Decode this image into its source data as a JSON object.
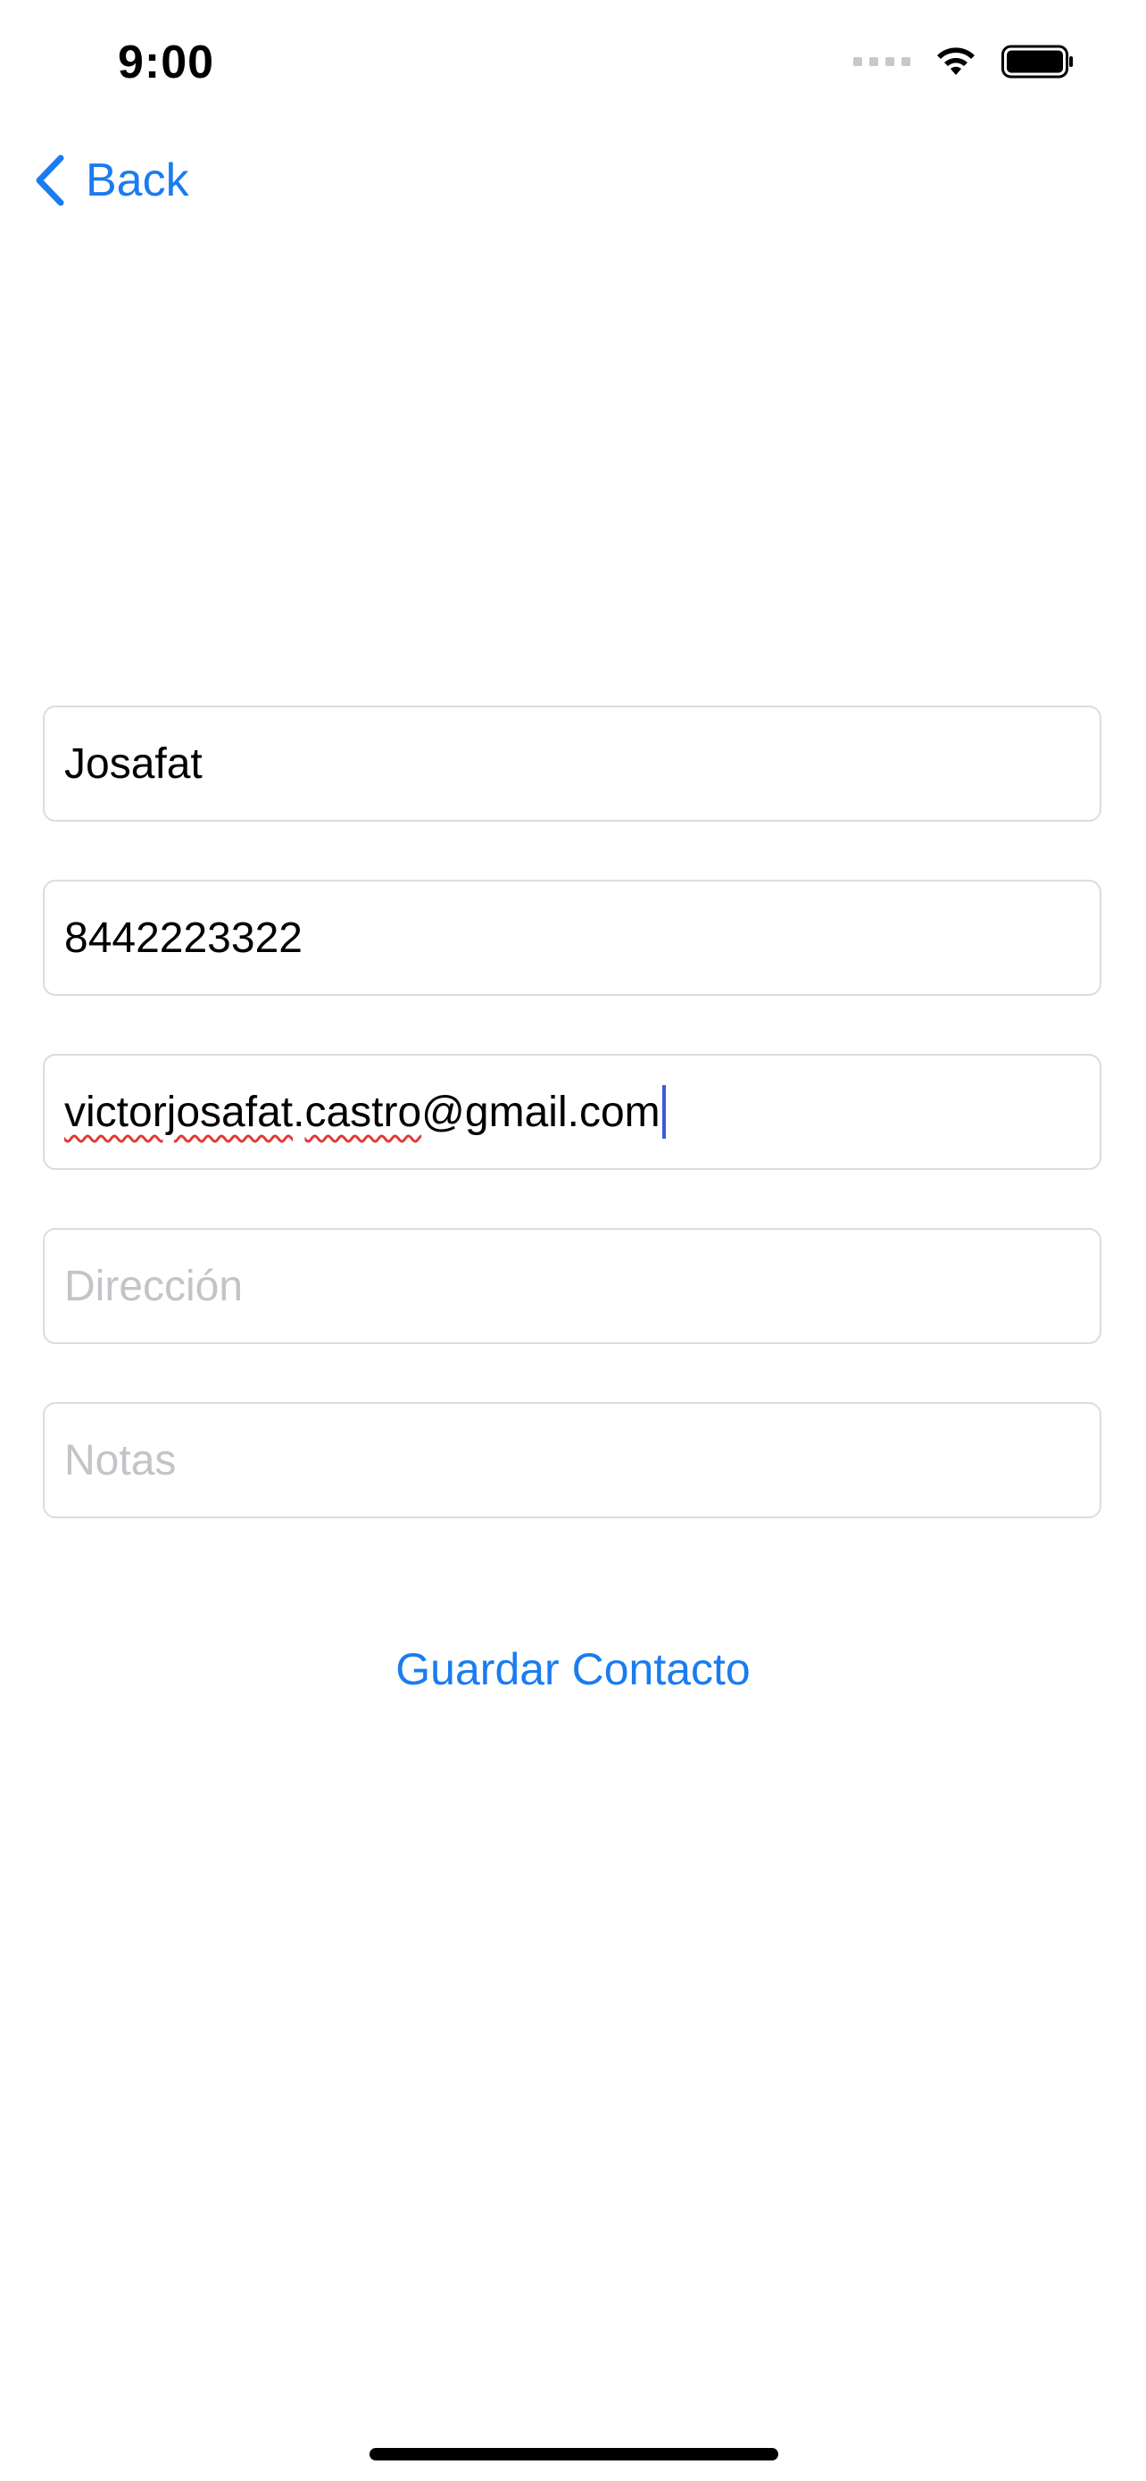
{
  "status_bar": {
    "time": "9:00",
    "icons": [
      "signal-icon",
      "wifi-icon",
      "battery-icon"
    ]
  },
  "nav": {
    "back_label": "Back",
    "back_icon": "chevron-left-icon"
  },
  "form": {
    "name": {
      "value": "Josafat",
      "placeholder": ""
    },
    "phone": {
      "value": "8442223322",
      "placeholder": ""
    },
    "email": {
      "value_part1": "victorjosafat",
      "value_part2": ".",
      "value_part3": "castro",
      "value_part4": "@gmail.com"
    },
    "address": {
      "value": "",
      "placeholder": "Dirección"
    },
    "notes": {
      "value": "",
      "placeholder": "Notas"
    }
  },
  "actions": {
    "save_label": "Guardar Contacto"
  },
  "colors": {
    "accent": "#1a7cf0",
    "field_border": "#dcdce0",
    "placeholder": "#c3c3c8",
    "caret": "#3b5bdb",
    "spellcheck": "#e53935"
  }
}
